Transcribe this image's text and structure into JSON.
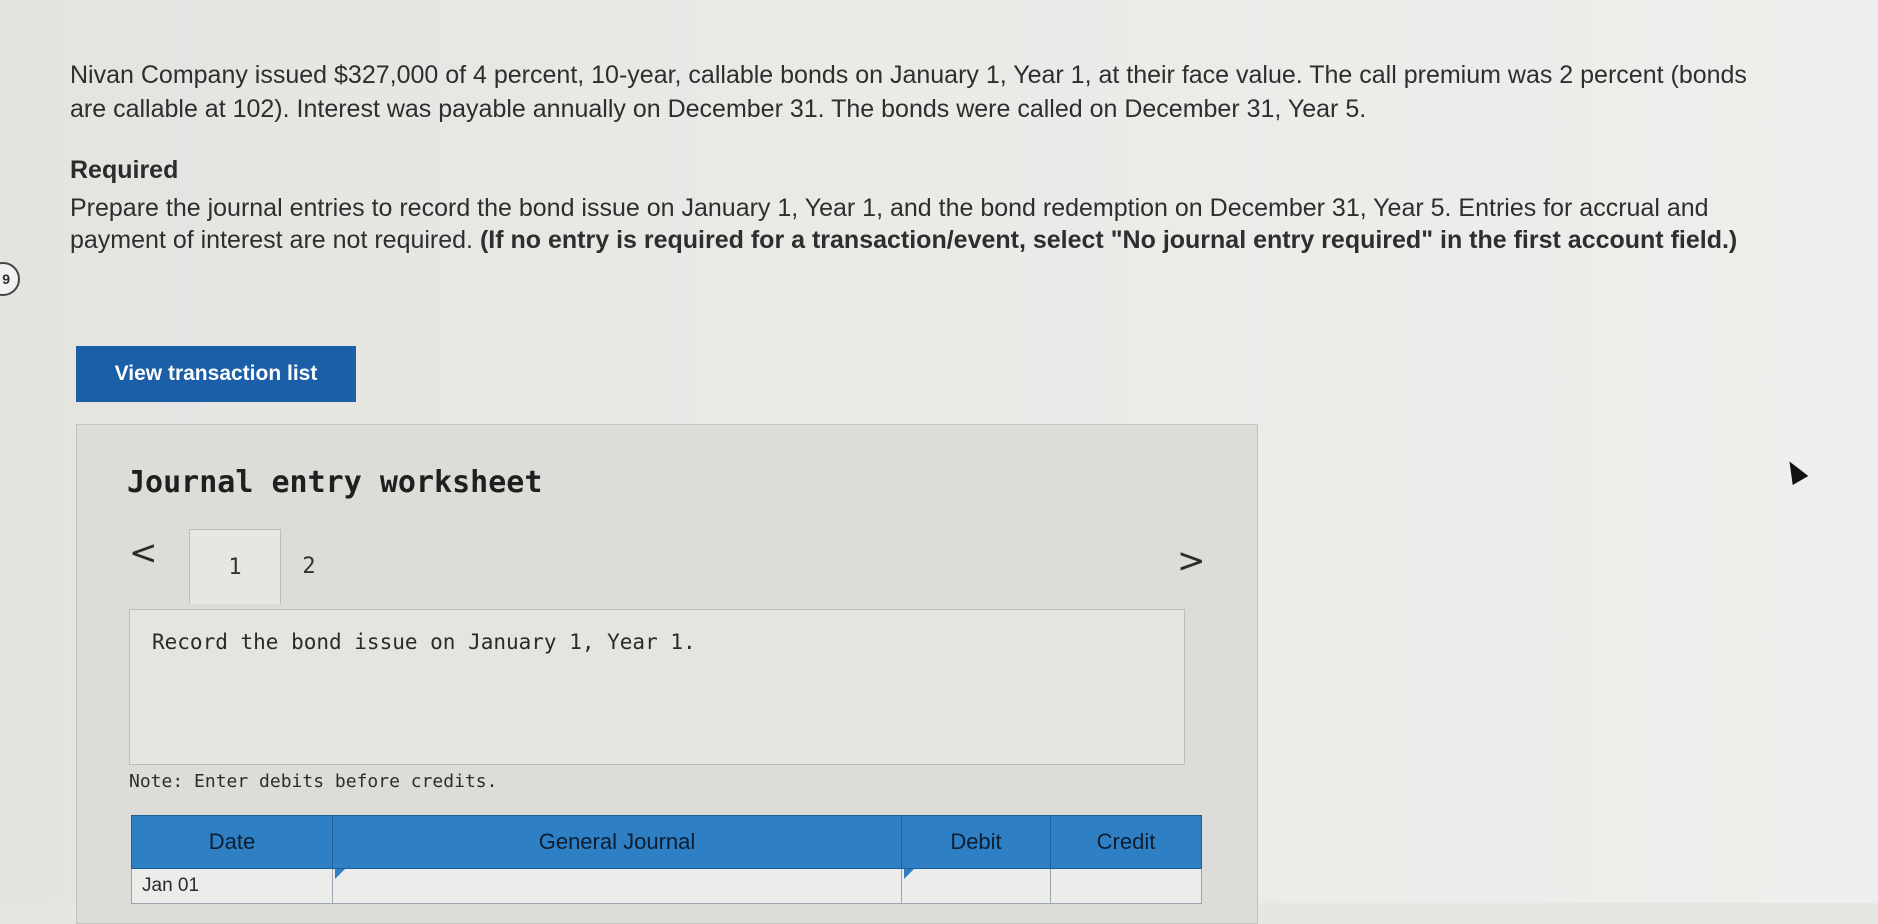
{
  "problem_text": "Nivan Company issued $327,000 of 4 percent, 10-year, callable bonds on January 1, Year 1, at their face value. The call premium was 2 percent (bonds are callable at 102). Interest was payable annually on December 31. The bonds were called on December 31, Year 5.",
  "required_heading": "Required",
  "instructions": {
    "text": "Prepare the journal entries to record the bond issue on January 1, Year 1, and the bond redemption on December 31, Year 5. Entries for accrual and payment of interest are not required.",
    "emphasis": "(If no entry is required for a transaction/event, select \"No journal entry required\" in the first account field.)"
  },
  "side_marker": "9",
  "view_button_label": "View transaction list",
  "worksheet": {
    "title": "Journal entry worksheet",
    "prev_icon": "<",
    "next_icon": ">",
    "tabs": [
      "1",
      "2"
    ],
    "prompt": "Record the bond issue on January 1, Year 1.",
    "note": "Note: Enter debits before credits.",
    "table": {
      "headers": {
        "date": "Date",
        "account": "General Journal",
        "debit": "Debit",
        "credit": "Credit"
      },
      "rows": [
        {
          "date": "Jan 01",
          "account": "",
          "debit": "",
          "credit": ""
        }
      ]
    }
  },
  "colors": {
    "button_bg": "#1b5fa8",
    "table_header_bg": "#2f7fc4"
  },
  "icons": {
    "prev": "chevron-left-icon",
    "next": "chevron-right-icon",
    "cursor": "mouse-pointer-icon"
  }
}
